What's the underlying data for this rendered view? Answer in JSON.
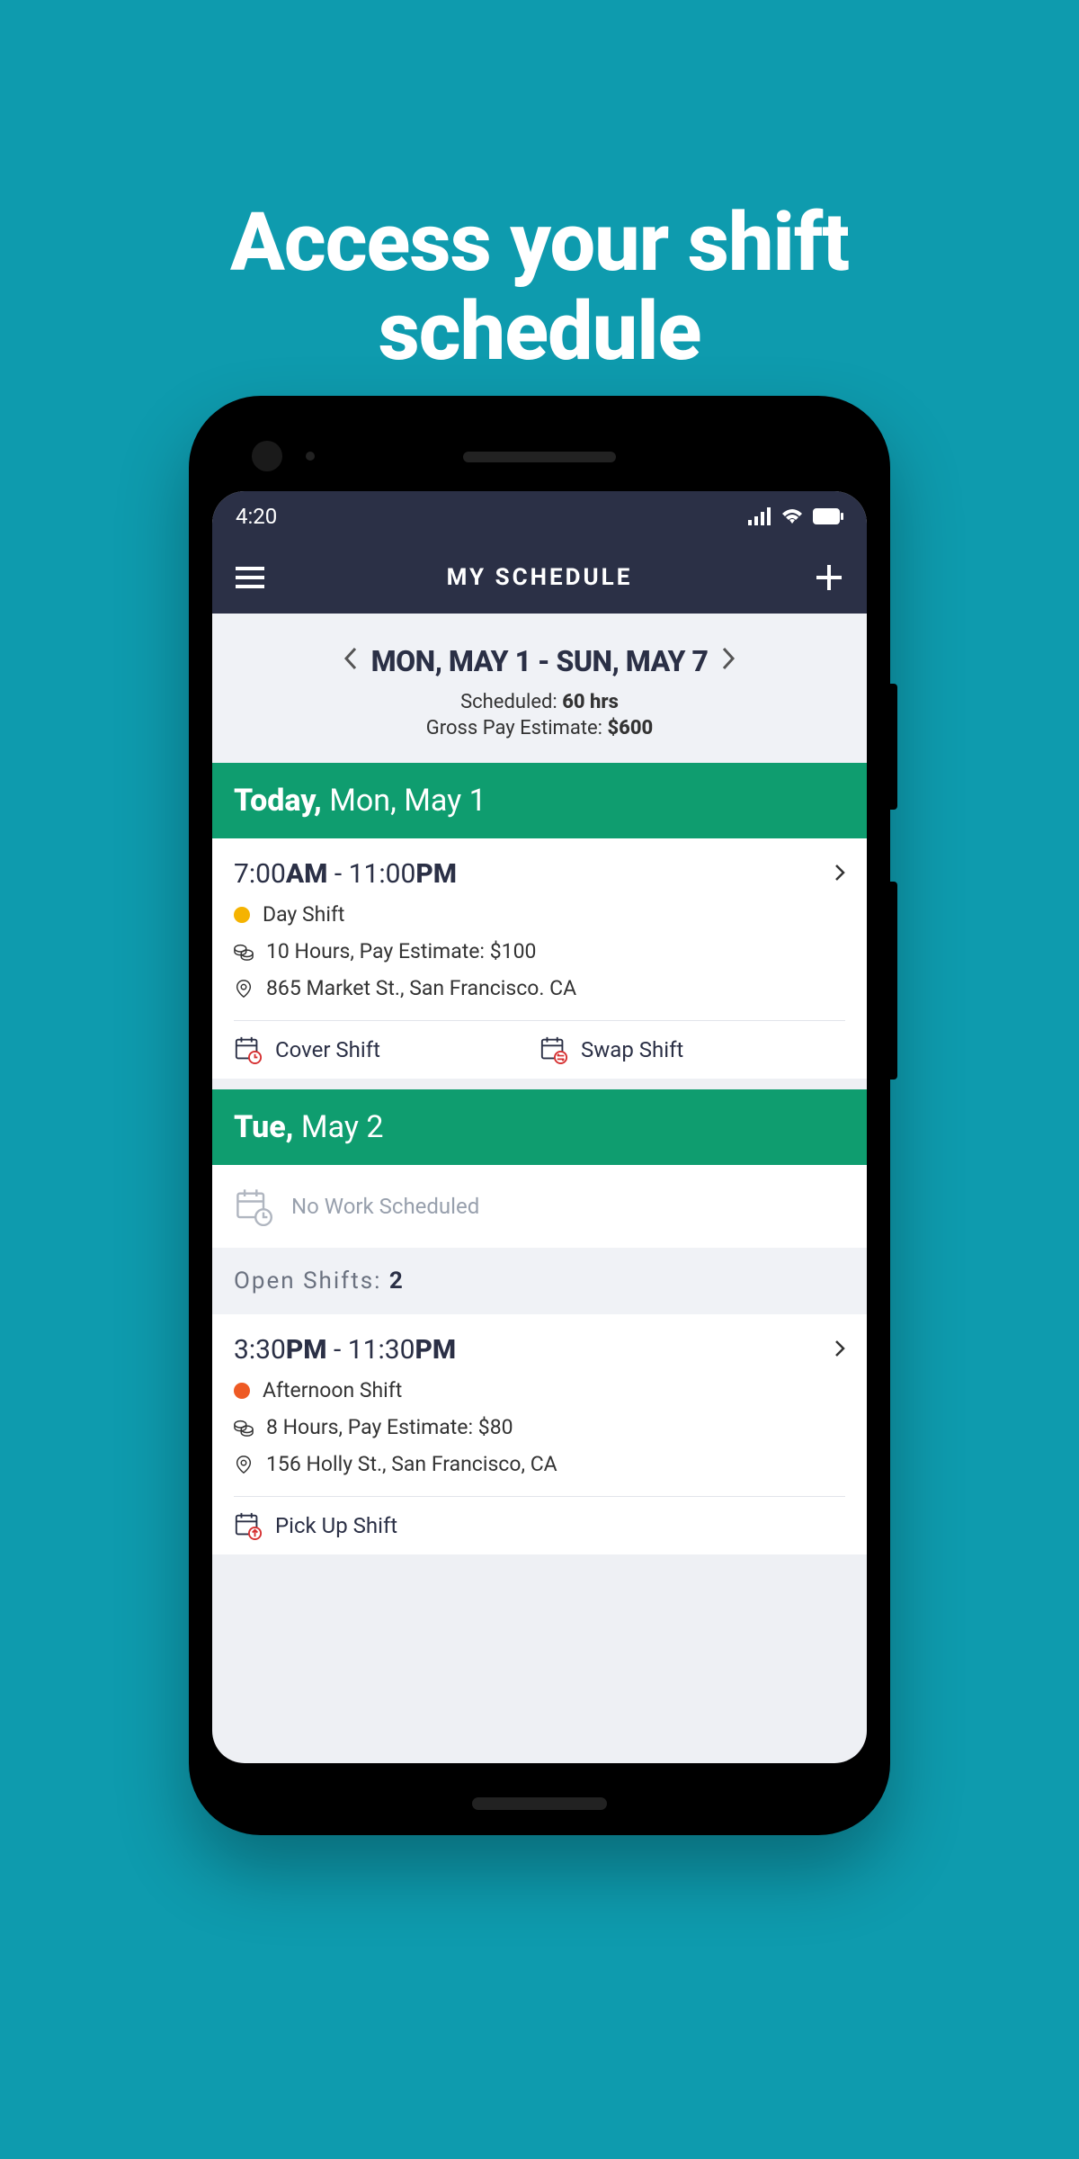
{
  "promo": {
    "title_line1": "Access your shift",
    "title_line2": "schedule"
  },
  "statusbar": {
    "time": "4:20"
  },
  "nav": {
    "title": "MY SCHEDULE"
  },
  "week": {
    "range": "MON, MAY 1 - SUN, MAY 7",
    "scheduled_label": "Scheduled: ",
    "scheduled_value": "60 hrs",
    "gross_label": "Gross Pay Estimate: ",
    "gross_value": "$600"
  },
  "day1": {
    "lead": "Today,",
    "rest": " Mon, May 1",
    "shift": {
      "t1": "7:00",
      "t1u": "AM",
      "dash": " - ",
      "t2": "11:00",
      "t2u": "PM",
      "name": "Day Shift",
      "hours": "10 Hours, Pay Estimate: $100",
      "location": "865 Market St., San Francisco. CA"
    },
    "actions": {
      "cover": "Cover Shift",
      "swap": "Swap Shift"
    }
  },
  "day2": {
    "lead": "Tue,",
    "rest": " May 2",
    "no_work": "No Work Scheduled"
  },
  "open": {
    "label": "Open Shifts: ",
    "count": "2",
    "shift": {
      "t1": "3:30",
      "t1u": "PM",
      "dash": " - ",
      "t2": "11:30",
      "t2u": "PM",
      "name": "Afternoon Shift",
      "hours": "8 Hours, Pay Estimate: $80",
      "location": "156 Holly St., San Francisco, CA"
    },
    "actions": {
      "pickup": "Pick Up Shift"
    }
  }
}
